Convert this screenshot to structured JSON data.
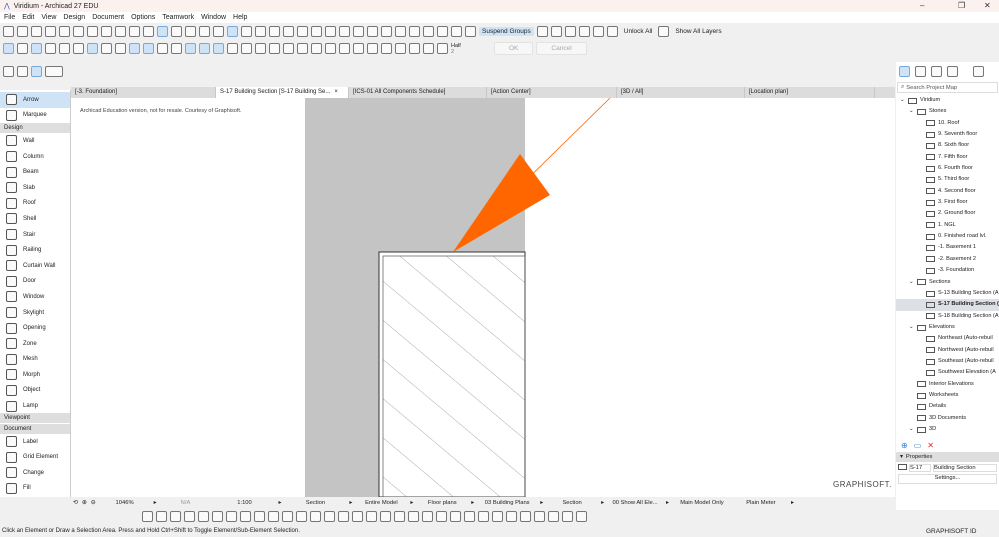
{
  "window": {
    "title": "Viridium - Archicad 27 EDU",
    "minimize": "–",
    "maximize": "❐",
    "close": "✕"
  },
  "menu": [
    "File",
    "Edit",
    "View",
    "Design",
    "Document",
    "Options",
    "Teamwork",
    "Window",
    "Help"
  ],
  "toolbar": {
    "suspend_groups": "Suspend Groups",
    "unlock_all": "Unlock All",
    "show_all_layers": "Show All Layers",
    "pen_label": "Half",
    "pen_number": "2",
    "ok": "OK",
    "cancel": "Cancel"
  },
  "tabs": [
    {
      "label": "[-3. Foundation]"
    },
    {
      "label": "S-17 Building Section [S-17 Building Se...",
      "close": "×",
      "active": true
    },
    {
      "label": "[ICS-01 All Components Schedule]"
    },
    {
      "label": "[Action Center]"
    },
    {
      "label": "[3D / All]"
    },
    {
      "label": "[Location plan]"
    }
  ],
  "toolbox": {
    "top": [
      "Arrow",
      "Marquee"
    ],
    "design_header": "Design",
    "design": [
      "Wall",
      "Column",
      "Beam",
      "Slab",
      "Roof",
      "Shell",
      "Stair",
      "Railing",
      "Curtain Wall",
      "Door",
      "Window",
      "Skylight",
      "Opening",
      "Zone",
      "Mesh",
      "Morph",
      "Object",
      "Lamp"
    ],
    "viewpoint_header": "Viewpoint",
    "document_header": "Document",
    "document": [
      "Label",
      "Grid Element",
      "Change",
      "Fill"
    ]
  },
  "canvas": {
    "watermark": "Archicad Education version, not for resale. Courtesy of Graphisoft.",
    "logo": "GRAPHISOFT.",
    "accent": "#ff6600"
  },
  "navigator": {
    "search_placeholder": "Search Project Map",
    "tree": [
      {
        "label": "Viridium",
        "level": 0,
        "expanded": true
      },
      {
        "label": "Stories",
        "level": 1,
        "expanded": true
      },
      {
        "label": "10. Roof",
        "level": 2
      },
      {
        "label": "9. Seventh floor",
        "level": 2
      },
      {
        "label": "8. Sixth floor",
        "level": 2
      },
      {
        "label": "7. Fifth floor",
        "level": 2
      },
      {
        "label": "6. Fourth floor",
        "level": 2
      },
      {
        "label": "5. Third floor",
        "level": 2
      },
      {
        "label": "4. Second floor",
        "level": 2
      },
      {
        "label": "3. First floor",
        "level": 2
      },
      {
        "label": "2. Ground floor",
        "level": 2
      },
      {
        "label": "1. NGL",
        "level": 2
      },
      {
        "label": "0. Finished road lvl.",
        "level": 2
      },
      {
        "label": "-1. Basement 1",
        "level": 2
      },
      {
        "label": "-2. Basement 2",
        "level": 2
      },
      {
        "label": "-3. Foundation",
        "level": 2
      },
      {
        "label": "Sections",
        "level": 1,
        "expanded": true
      },
      {
        "label": "S-13 Building Section (A",
        "level": 2
      },
      {
        "label": "S-17 Building Section (",
        "level": 2,
        "selected": true
      },
      {
        "label": "S-18 Building Section (A",
        "level": 2
      },
      {
        "label": "Elevations",
        "level": 1,
        "expanded": true
      },
      {
        "label": "Northeast (Auto-rebuil",
        "level": 2
      },
      {
        "label": "Northwest (Auto-rebuil",
        "level": 2
      },
      {
        "label": "Southeast (Auto-rebuil",
        "level": 2
      },
      {
        "label": "Southwest Elevation (A",
        "level": 2
      },
      {
        "label": "Interior Elevations",
        "level": 1
      },
      {
        "label": "Worksheets",
        "level": 1
      },
      {
        "label": "Details",
        "level": 1
      },
      {
        "label": "3D Documents",
        "level": 1
      },
      {
        "label": "3D",
        "level": 1,
        "expanded": true
      }
    ],
    "properties_header": "Properties",
    "prop_id": "S-17",
    "prop_name": "Building Section",
    "settings": "Settings..."
  },
  "bottom_bar": {
    "zoom": "1046%",
    "angle": "N/A",
    "scale": "1:100",
    "layer_combo": "Section",
    "model_view": "Entire Model",
    "pen_set": "Floor plans",
    "graphic_override": "03 Building Plans",
    "renovation": "Section",
    "structure": "00 Show All Ele...",
    "partial_structure": "Main Model Only",
    "dimension": "Plain Meter"
  },
  "status": {
    "message": "Click an Element or Draw a Selection Area. Press and Hold Ctrl+Shift to Toggle Element/Sub-Element Selection.",
    "graphisoft_id": "GRAPHISOFT ID"
  }
}
